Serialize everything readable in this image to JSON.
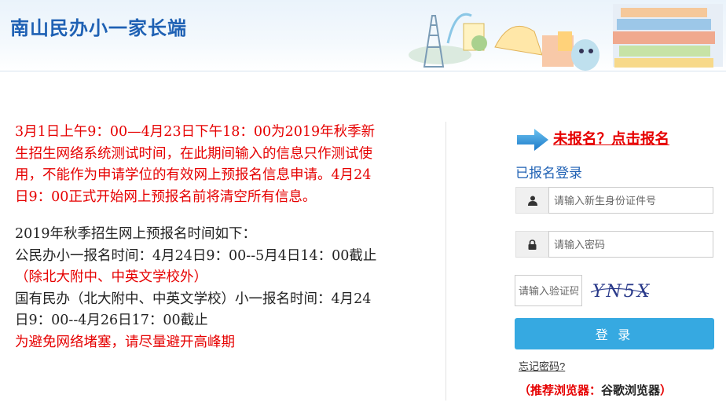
{
  "header": {
    "title": "南山民办小一家长端"
  },
  "notice": {
    "para1": "3月1日上午9：00—4月23日下午18：00为2019年秋季新生招生网络系统测试时间，在此期间输入的信息只作测试使用，不能作为申请学位的有效网上预报名信息申请。4月24日9：00正式开始网上预报名前将清空所有信息。",
    "schedule_title": "2019年秋季招生网上预报名时间如下：",
    "public_time": "公民办小一报名时间：4月24日9：00--5月4日14：00截止",
    "public_exception": "（除北大附中、中英文学校外）",
    "state_time": "国有民办（北大附中、中英文学校）小一报名时间：4月24日9：00--4月26日17：00截止",
    "avoid_peak": "为避免网络堵塞，请尽量避开高峰期"
  },
  "login": {
    "register_link": "未报名？点击报名",
    "title": "已报名登录",
    "id_placeholder": "请输入新生身份证件号",
    "password_placeholder": "请输入密码",
    "captcha_placeholder": "请输入验证码",
    "captcha_text": "YN5X",
    "submit_label": "登 录",
    "forgot_label": "忘记密码?",
    "browser_label": "（推荐浏览器：",
    "browser_value": "谷歌浏览器",
    "browser_close": "）"
  },
  "colors": {
    "brand_blue": "#1f61b4",
    "button_blue": "#36a9e1",
    "notice_red": "#e60000"
  },
  "icons": {
    "user": "user-icon",
    "lock": "lock-icon",
    "arrow": "arrow-right-icon"
  }
}
